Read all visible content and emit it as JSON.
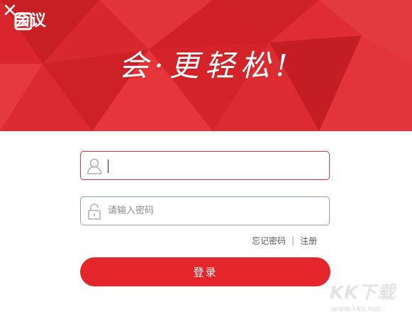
{
  "app": {
    "logo_text": "会议",
    "slogan": "会·更轻松!"
  },
  "form": {
    "username_value": "",
    "password_placeholder": "请输入密码",
    "forgot_password": "忘记密码",
    "separator": "|",
    "register": "注册",
    "login_label": "登录"
  },
  "watermark": {
    "brand": "KK下载",
    "url": "www.kkx.net"
  },
  "colors": {
    "accent": "#e3262c",
    "banner": "#d9252b"
  },
  "icons": [
    "logo-mark-icon",
    "close-icon",
    "user-icon",
    "lock-icon"
  ]
}
